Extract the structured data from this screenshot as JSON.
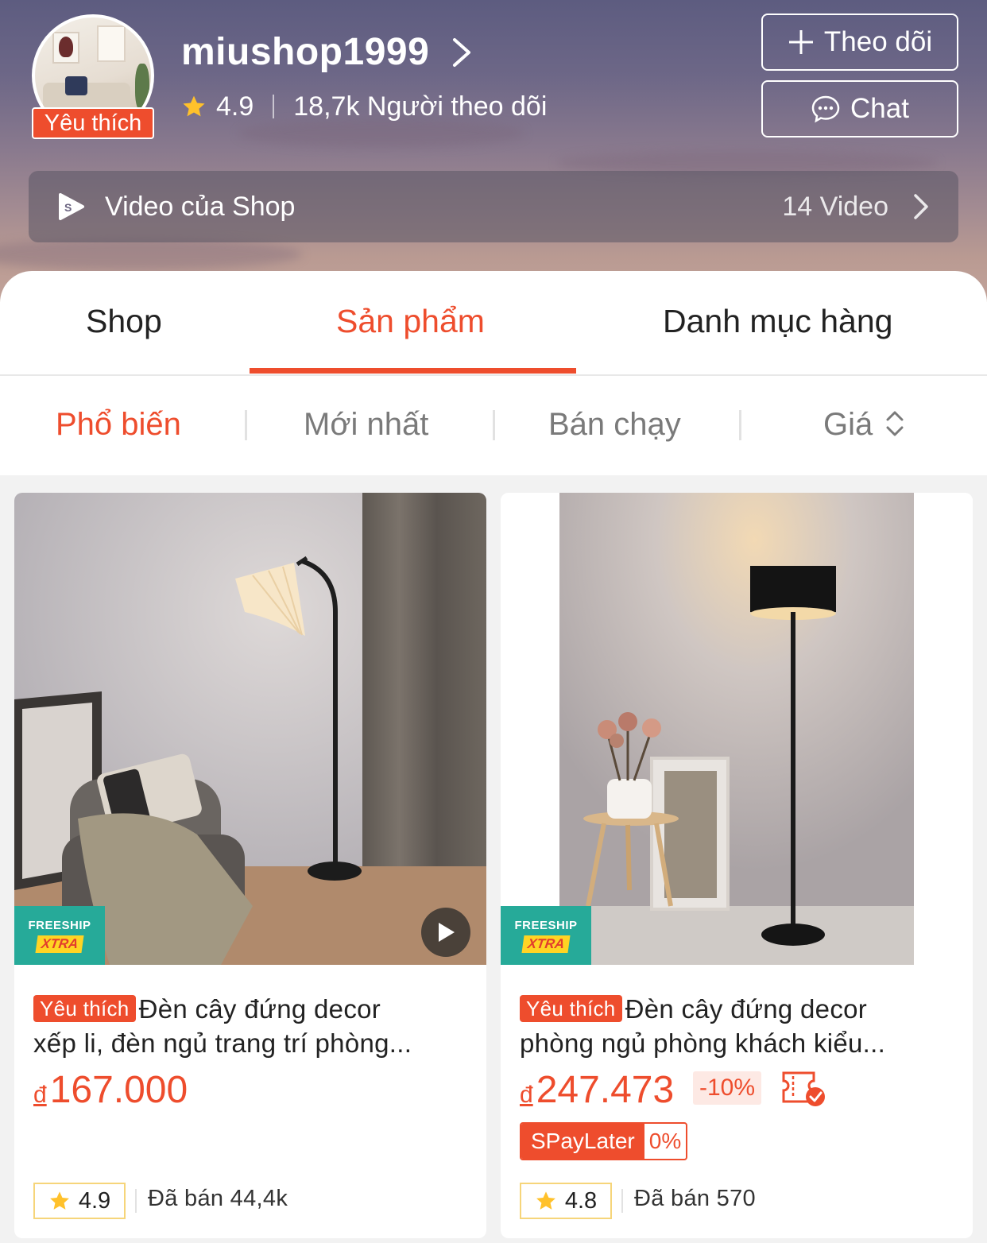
{
  "shop": {
    "name": "miushop1999",
    "favorite_badge": "Yêu thích",
    "rating": "4.9",
    "followers": "18,7k Người theo dõi",
    "follow_label": "Theo dõi",
    "chat_label": "Chat"
  },
  "video_bar": {
    "label": "Video của Shop",
    "count": "14 Video"
  },
  "tabs": [
    {
      "label": "Shop",
      "active": false
    },
    {
      "label": "Sản phẩm",
      "active": true
    },
    {
      "label": "Danh mục hàng",
      "active": false
    }
  ],
  "sort": {
    "popular": "Phổ biến",
    "newest": "Mới nhất",
    "best_selling": "Bán chạy",
    "price": "Giá"
  },
  "products": [
    {
      "tag": "Yêu thích",
      "title_line1": "Đèn cây đứng decor",
      "title_line2": "xếp li, đèn ngủ trang trí phòng...",
      "currency": "đ",
      "price": "167.000",
      "rating": "4.9",
      "sold": "Đã bán 44,4k",
      "freeship_top": "FREESHIP",
      "freeship_bottom": "XTRA"
    },
    {
      "tag": "Yêu thích",
      "title_line1": "Đèn cây đứng decor",
      "title_line2": "phòng ngủ phòng khách kiểu...",
      "currency": "đ",
      "price": "247.473",
      "discount": "-10%",
      "spaylater": "SPayLater",
      "spaylater_rate": "0%",
      "rating": "4.8",
      "sold": "Đã bán 570",
      "freeship_top": "FREESHIP",
      "freeship_bottom": "XTRA"
    }
  ],
  "colors": {
    "accent": "#ee4d2d",
    "freeship": "#26aa99",
    "rating_border": "#f6d57a"
  }
}
